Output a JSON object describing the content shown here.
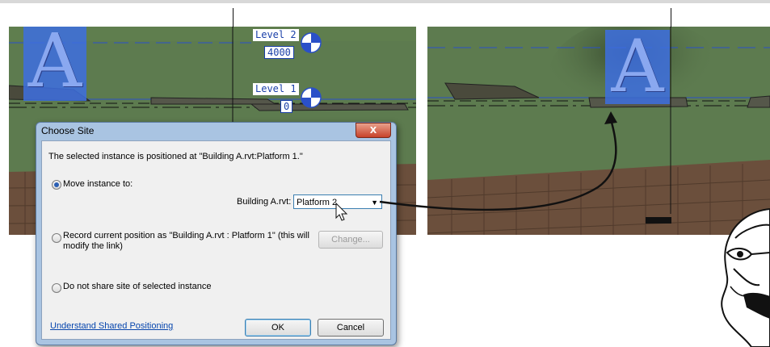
{
  "levels": [
    {
      "name": "Level 2",
      "elevation": "4000"
    },
    {
      "name": "Level 1",
      "elevation": "0"
    }
  ],
  "building_letter": "A",
  "dialog": {
    "title": "Choose Site",
    "close_label": "X",
    "message": "The selected instance is positioned at \"Building A.rvt:Platform 1.\"",
    "option_move": "Move instance to:",
    "link_label": "Building A.rvt:",
    "platform_value": "Platform 2",
    "option_record_line1": "Record current position as \"Building A.rvt : Platform 1\" (this will",
    "option_record_line2": "modify the link)",
    "change_button": "Change...",
    "option_no_share": "Do not share site of selected instance",
    "help_link": "Understand Shared Positioning",
    "ok_button": "OK",
    "cancel_button": "Cancel",
    "selected_option": "move"
  },
  "colors": {
    "grass": "#5c7a4e",
    "soil": "#6b4f3c",
    "level_line": "#2a50c8",
    "selection": "#3d6fe0"
  }
}
